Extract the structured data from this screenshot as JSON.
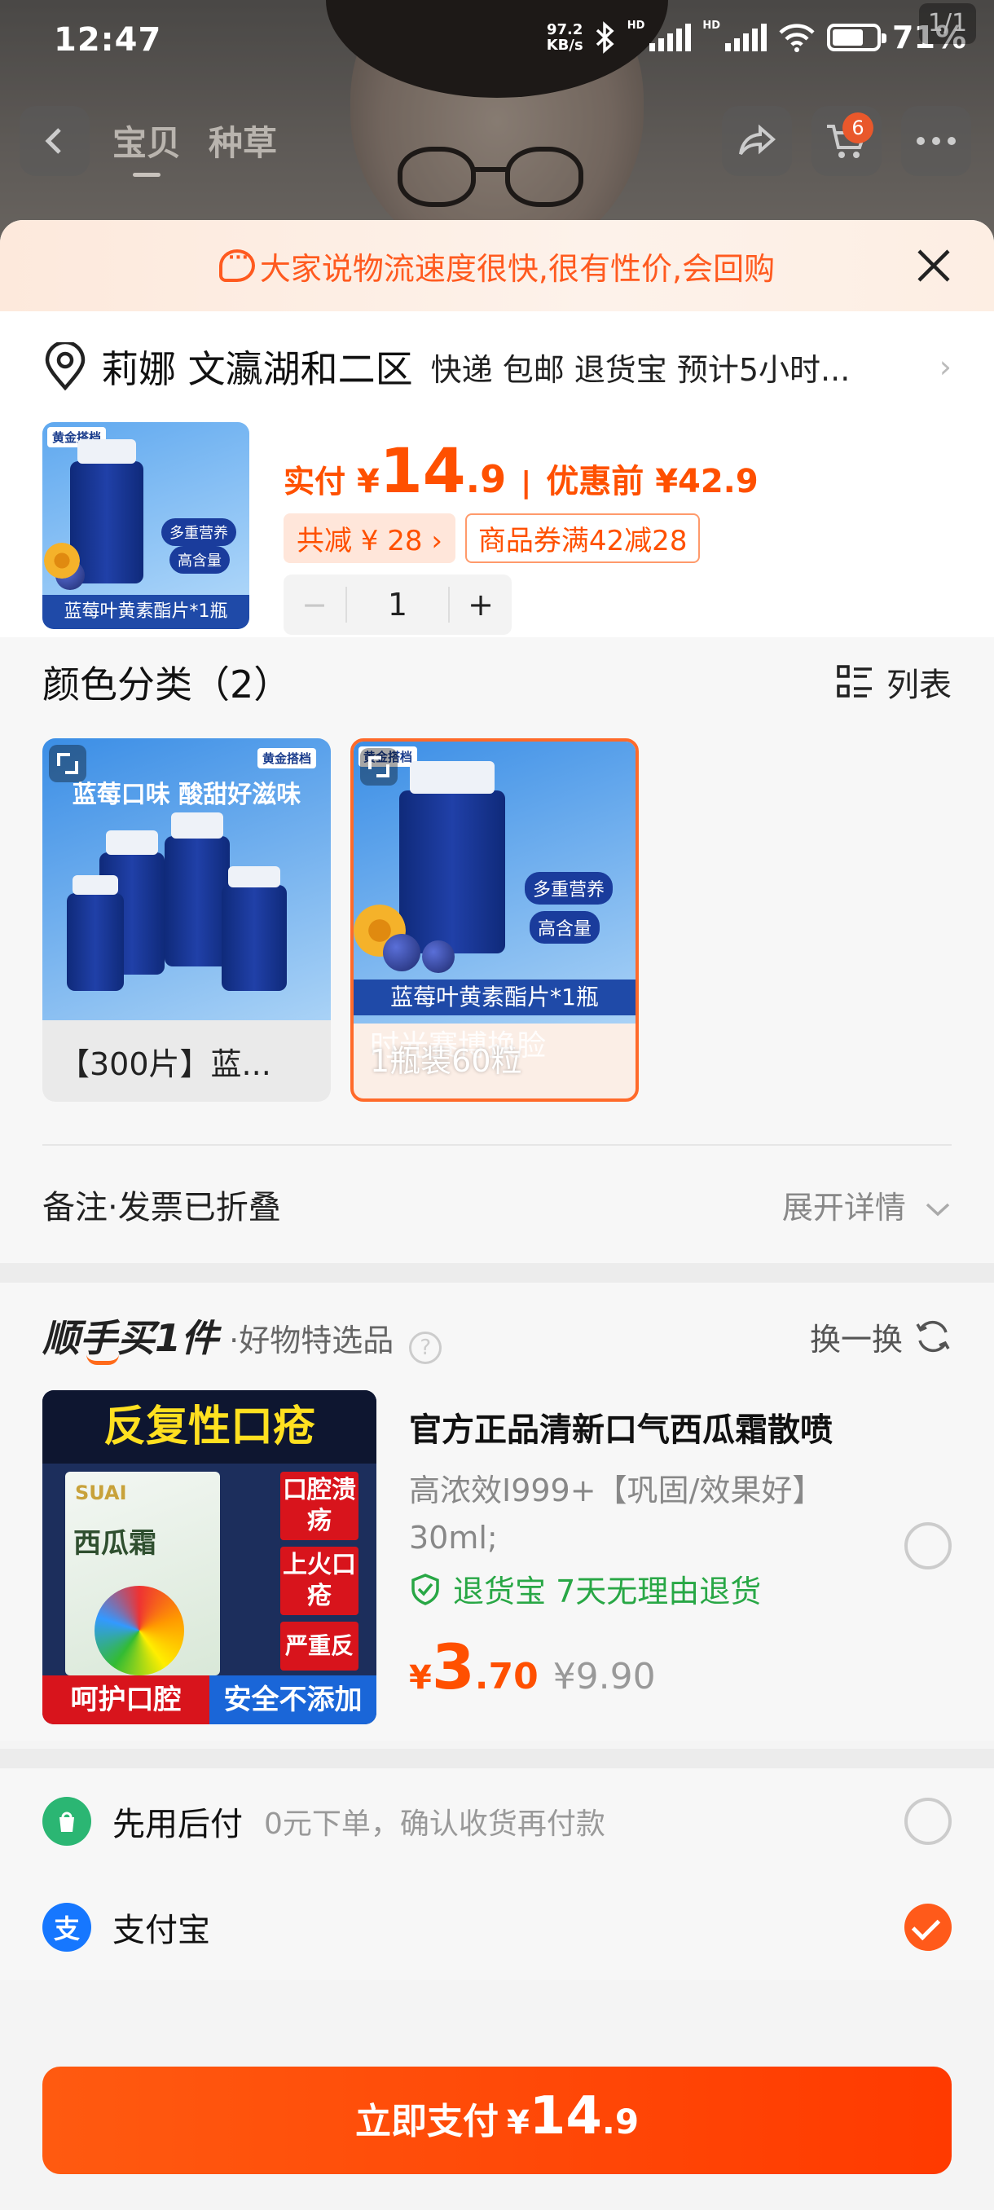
{
  "status_bar": {
    "time": "12:47",
    "speed_value": "97.2",
    "speed_unit": "KB/s",
    "hd1": "HD",
    "hd2": "HD",
    "battery": "71%",
    "battery_level": 0.71
  },
  "page_counter": "1/1",
  "nav": {
    "tabs": [
      "宝贝",
      "种草"
    ],
    "active_tab": 0,
    "cart_badge": "6"
  },
  "banner": {
    "text": "大家说物流速度很快,很有性价,会回购"
  },
  "address": {
    "name": "莉娜 文瀛湖和二区",
    "meta": "快递 包邮 退货宝 预计5小时..."
  },
  "product": {
    "thumb_brand": "黄金搭档",
    "thumb_caption": "蓝莓叶黄素酯片*1瓶",
    "thumb_pill1": "多重营养",
    "thumb_pill2": "高含量",
    "pay_label": "实付",
    "currency": "¥",
    "price_int": "14",
    "price_dec": ".9",
    "sep": "|",
    "before_label": "优惠前 ¥42.9",
    "save_tag": "共减 ¥ 28 ›",
    "coupon_tag": "商品券满42减28",
    "qty_minus": "−",
    "qty": "1",
    "qty_plus": "+"
  },
  "colors": {
    "title": "颜色分类（2）",
    "list_label": "列表",
    "variants": [
      {
        "label": "【300片】蓝...",
        "headline": "蓝莓口味 酸甜好滋味",
        "brand": "黄金搭档",
        "selected": false
      },
      {
        "label": "1瓶装60粒",
        "headline": "",
        "brand": "黄金搭档",
        "caption": "蓝莓叶黄素酯片*1瓶",
        "overlay": "时光赛博换脸",
        "selected": true
      }
    ]
  },
  "remark": {
    "title": "备注·发票已折叠",
    "expand": "展开详情"
  },
  "addon": {
    "logo": "顺手买1件",
    "subtitle": "·好物特选品",
    "help": "?",
    "swap": "换一换",
    "item": {
      "img_top": "反复性口疮",
      "img_box_title": "西瓜霜",
      "img_box_brand": "SUAI",
      "img_red": [
        "口腔溃疡",
        "上火口疮",
        "严重反复"
      ],
      "img_bottom_left": "呵护口腔",
      "img_bottom_right": "安全不添加",
      "title": "官方正品清新口气西瓜霜散喷",
      "desc": "高浓效I999+【巩固/效果好】30ml;",
      "guarantee": "退货宝  7天无理由退货",
      "currency": "¥",
      "price_int": "3",
      "price_dec": ".70",
      "orig_price": "¥9.90",
      "checked": false
    }
  },
  "payment": {
    "options": [
      {
        "name": "先用后付",
        "note": "0元下单，确认收货再付款",
        "checked": false,
        "color": "#2bb673"
      },
      {
        "name": "支付宝",
        "note": "",
        "checked": true,
        "color": "#1677ff"
      }
    ]
  },
  "pay_button": {
    "label": "立即支付",
    "currency": "¥",
    "int": "14",
    "dec": ".9"
  },
  "colors_theme": {
    "accent": "#ff5000",
    "banner_bg": "#fde9dc",
    "success": "#28a745",
    "alipay": "#1677ff"
  }
}
